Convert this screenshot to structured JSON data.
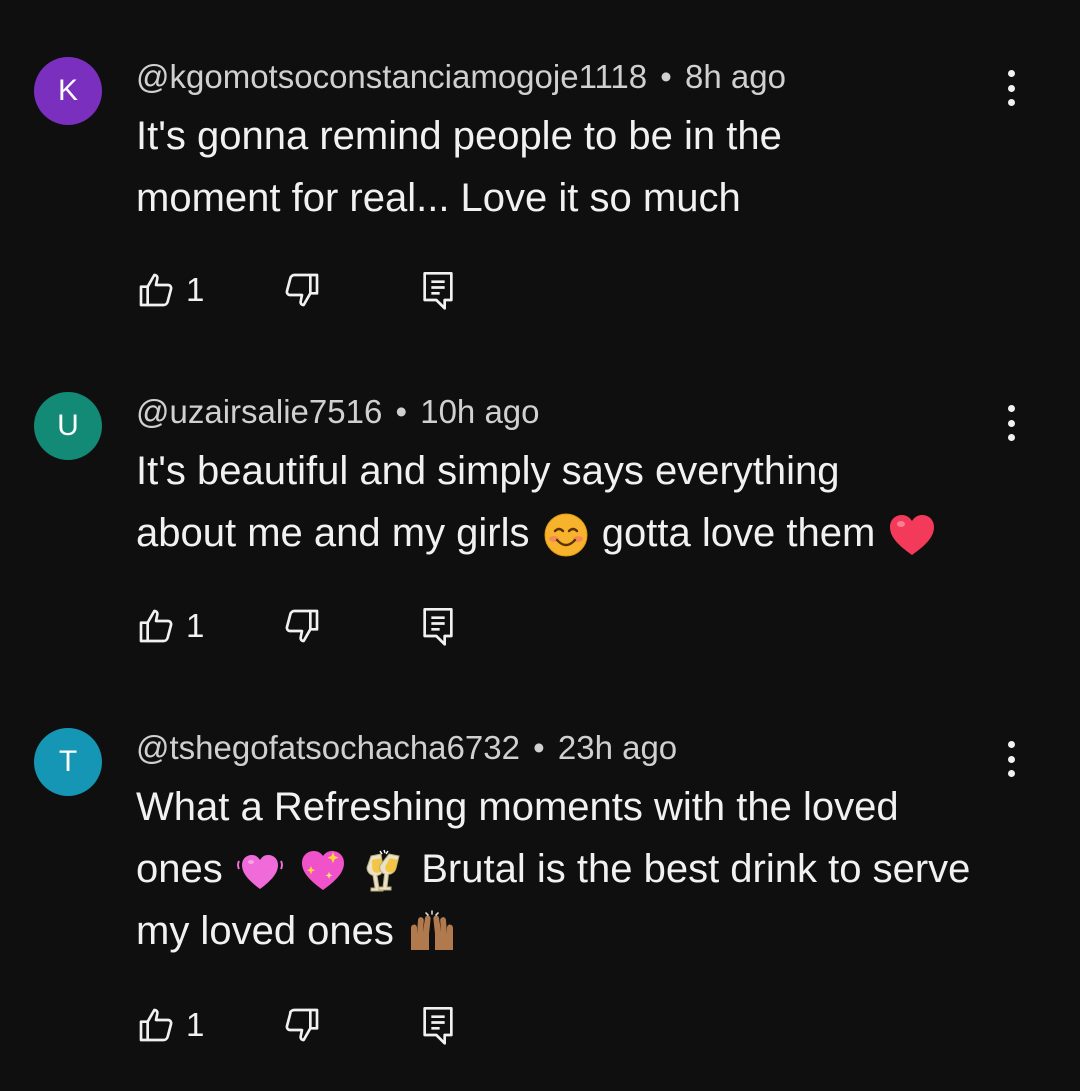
{
  "comments": [
    {
      "avatar_letter": "K",
      "avatar_color": "#7b2fbf",
      "handle": "@kgomotsoconstanciamogoje1118",
      "separator": "•",
      "time": "8h ago",
      "lines": [
        "It's gonna remind people to be in the",
        "moment for real... Love it so much"
      ],
      "likes": "1"
    },
    {
      "avatar_letter": "U",
      "avatar_color": "#138a76",
      "handle": "@uzairsalie7516",
      "separator": "•",
      "time": "10h ago",
      "line1": "It's beautiful and simply says everything",
      "line2_a": "about me and my girls",
      "line2_b": "gotta love them",
      "likes": "1"
    },
    {
      "avatar_letter": "T",
      "avatar_color": "#1596b4",
      "handle": "@tshegofatsochacha6732",
      "separator": "•",
      "time": "23h ago",
      "line1": "What a Refreshing moments with the loved",
      "line2_a": "ones",
      "line2_b": "Brutal is the best drink to serve",
      "line3": "my loved ones",
      "likes": "1"
    }
  ],
  "icons": {
    "like": "thumbs-up-icon",
    "dislike": "thumbs-down-icon",
    "reply": "reply-icon",
    "more": "more-vertical-icon"
  }
}
